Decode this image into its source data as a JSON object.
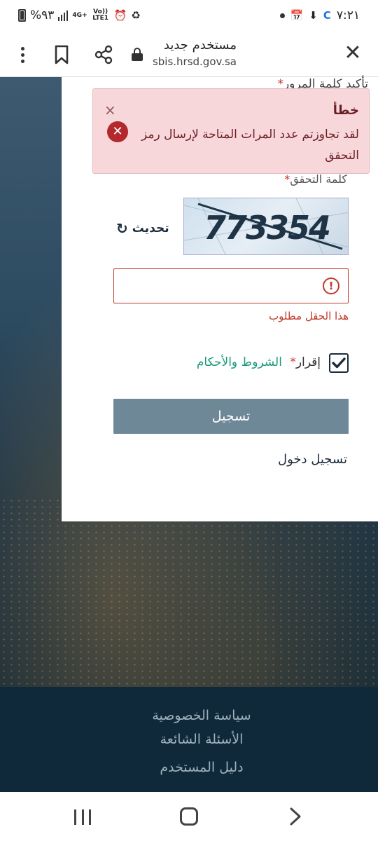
{
  "status_bar": {
    "time": "٧:٢١",
    "battery": "%٩٣",
    "network_top": "4G+",
    "network_label": "Vo)) LTE1"
  },
  "browser": {
    "page_title": "مستخدم جديد",
    "url": "sbis.hrsd.gov.sa"
  },
  "form": {
    "top_partial_label": "تأكيد كلمة المرور",
    "captcha_label": "كلمة التحقق",
    "captcha_text": "773354",
    "refresh_label": "تحديث",
    "captcha_input_value": "",
    "field_error": "هذا الحقل مطلوب",
    "terms_prefix": "إقرار",
    "terms_link": "الشروط والأحكام",
    "terms_checked": true,
    "register_button": "تسجيل",
    "login_link": "تسجيل دخول",
    "required_mark": "*"
  },
  "toast": {
    "title": "خطأ",
    "message": "لقد تجاوزتم عدد المرات المتاحة لإرسال رمز التحقق",
    "close": "×",
    "icon": "error-x-icon"
  },
  "footer": {
    "links": [
      "سياسة الخصوصية",
      "الأسئلة الشائعة",
      "دليل المستخدم"
    ]
  },
  "colors": {
    "error": "#c0392b",
    "link_green": "#1a9a7a",
    "button": "#6f8898",
    "footer_bg": "#10293a",
    "toast_bg": "#f8d7da"
  }
}
